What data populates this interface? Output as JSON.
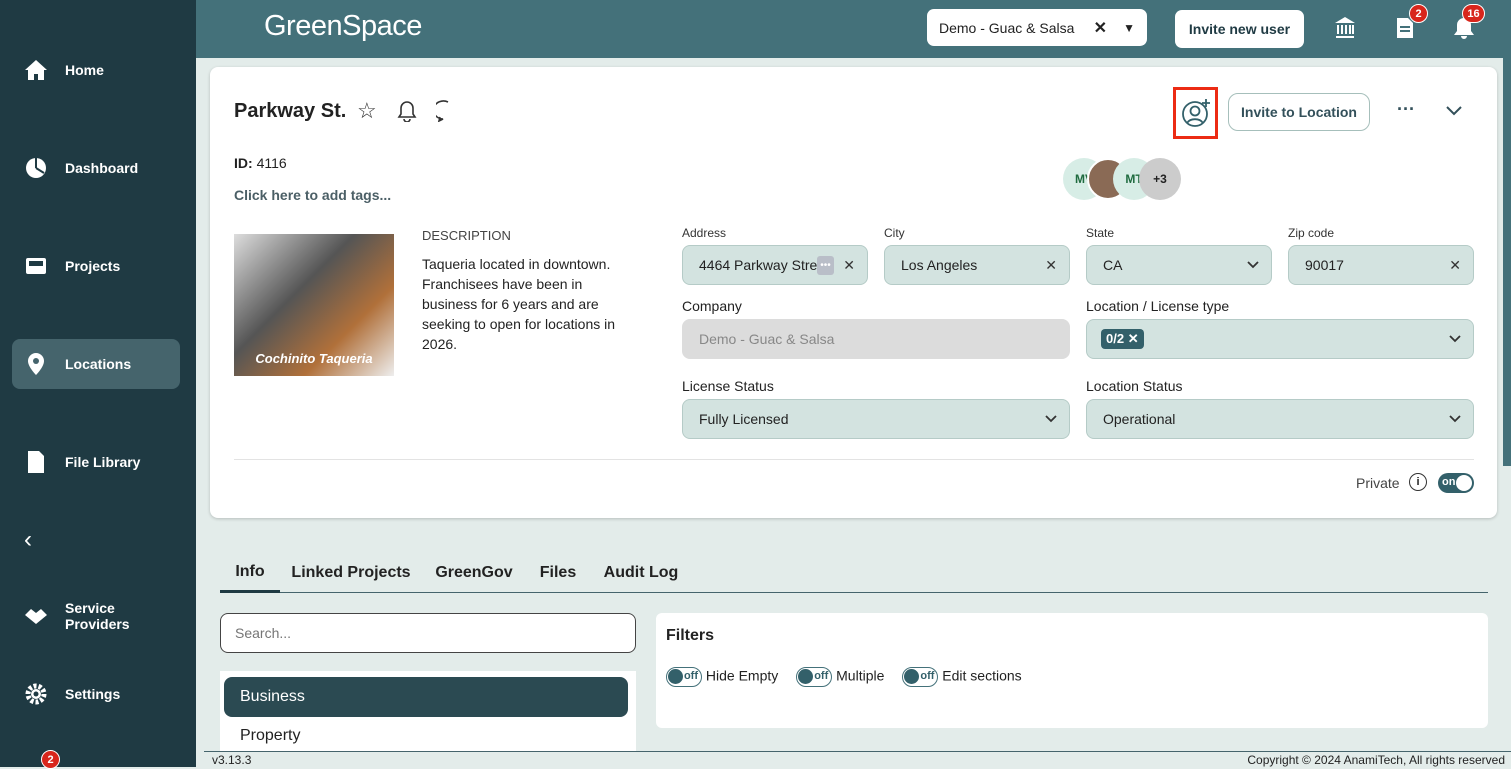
{
  "sidebar": {
    "items": [
      {
        "label": "Home"
      },
      {
        "label": "Dashboard"
      },
      {
        "label": "Projects"
      },
      {
        "label": "Locations"
      },
      {
        "label": "File Library"
      },
      {
        "label": "Service Providers"
      },
      {
        "label": "Settings"
      }
    ],
    "bottom_badge": "2"
  },
  "topbar": {
    "logo": "GreenSpace",
    "org": "Demo - Guac & Salsa",
    "invite_user": "Invite new user",
    "doc_badge": "2",
    "bell_badge": "16"
  },
  "location": {
    "title": "Parkway St.",
    "id_label": "ID:",
    "id": "4116",
    "tags": "Click here to add tags...",
    "avatars": [
      "MV",
      "MT",
      "+3"
    ],
    "invite": "Invite to Location",
    "description_label": "DESCRIPTION",
    "description": "Taqueria located in downtown. Franchisees have been in business for 6 years and are seeking to open for locations in 2026.",
    "image_text": "Cochinito Taqueria",
    "address_label": "Address",
    "address": "4464 Parkway Stre",
    "city_label": "City",
    "city": "Los Angeles",
    "state_label": "State",
    "state": "CA",
    "zip_label": "Zip code",
    "zip": "90017",
    "company_label": "Company",
    "company": "Demo - Guac & Salsa",
    "type_label": "Location / License type",
    "type_chip": "0/2",
    "license_status_label": "License Status",
    "license_status": "Fully Licensed",
    "location_status_label": "Location Status",
    "location_status": "Operational",
    "private_label": "Private",
    "private_toggle": "on"
  },
  "tabs": [
    "Info",
    "Linked Projects",
    "GreenGov",
    "Files",
    "Audit Log"
  ],
  "search": {
    "placeholder": "Search..."
  },
  "sections": [
    "Business",
    "Property"
  ],
  "filters": {
    "title": "Filters",
    "toggles": [
      {
        "label": "Hide Empty",
        "state": "off"
      },
      {
        "label": "Multiple",
        "state": "off"
      },
      {
        "label": "Edit sections",
        "state": "off"
      }
    ]
  },
  "footer": {
    "version": "v3.13.3",
    "copyright": "Copyright © 2024 AnamiTech, All rights reserved"
  }
}
